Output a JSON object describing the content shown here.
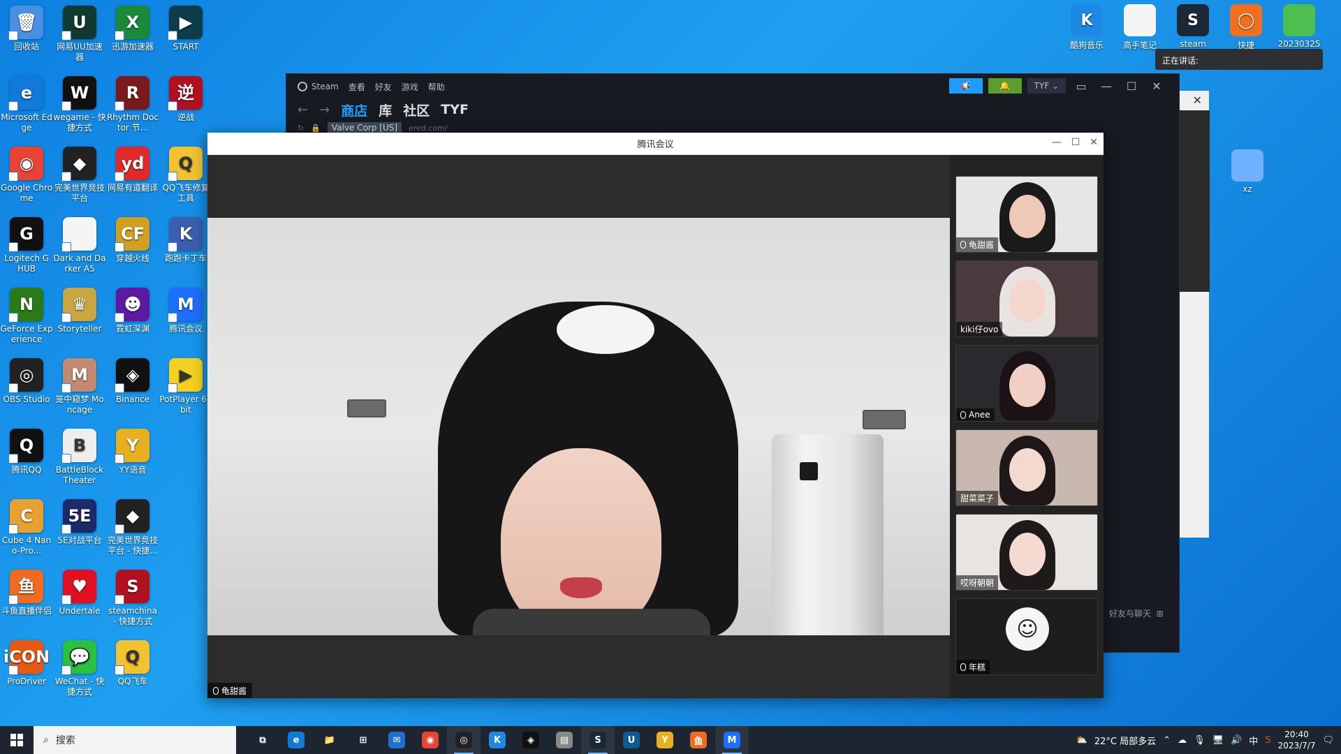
{
  "desktop": {
    "icons": [
      {
        "label": "回收站",
        "glyph": "🗑",
        "color": "#4a90e2"
      },
      {
        "label": "网易UU加速器",
        "glyph": "U",
        "color": "#0f3a2f"
      },
      {
        "label": "迅游加速器",
        "glyph": "X",
        "color": "#1a8a3a"
      },
      {
        "label": "START",
        "glyph": "▶",
        "color": "#0d3d4a"
      },
      {
        "label": "Microsoft Edge",
        "glyph": "e",
        "color": "#0f7ad8"
      },
      {
        "label": "wegame - 快捷方式",
        "glyph": "W",
        "color": "#111"
      },
      {
        "label": "Rhythm Doctor 节...",
        "glyph": "R",
        "color": "#7a1a1a"
      },
      {
        "label": "逆战",
        "glyph": "逆",
        "color": "#b01020"
      },
      {
        "label": "Google Chrome",
        "glyph": "◉",
        "color": "#e84335"
      },
      {
        "label": "完美世界竞技平台",
        "glyph": "◆",
        "color": "#222"
      },
      {
        "label": "网易有道翻译",
        "glyph": "yd",
        "color": "#e02a2a"
      },
      {
        "label": "QQ飞车修复工具",
        "glyph": "Q",
        "color": "#f2c230"
      },
      {
        "label": "Logitech G HUB",
        "glyph": "G",
        "color": "#111"
      },
      {
        "label": "Dark and Darker A5",
        "glyph": "",
        "color": "#f5f5f5"
      },
      {
        "label": "穿越火线",
        "glyph": "CF",
        "color": "#d1a020"
      },
      {
        "label": "跑跑卡丁车",
        "glyph": "K",
        "color": "#3a5fb0"
      },
      {
        "label": "GeForce Experience",
        "glyph": "N",
        "color": "#2a7a1a"
      },
      {
        "label": "Storyteller",
        "glyph": "♛",
        "color": "#caa640"
      },
      {
        "label": "霓虹深渊",
        "glyph": "☻",
        "color": "#5b1aa0"
      },
      {
        "label": "腾讯会议",
        "glyph": "M",
        "color": "#1e6fff"
      },
      {
        "label": "OBS Studio",
        "glyph": "◎",
        "color": "#222"
      },
      {
        "label": "笼中窥梦 Moncage",
        "glyph": "M",
        "color": "#c28a70"
      },
      {
        "label": "Binance",
        "glyph": "◈",
        "color": "#111"
      },
      {
        "label": "PotPlayer 64 bit",
        "glyph": "▶",
        "color": "#f5d020"
      },
      {
        "label": "腾讯QQ",
        "glyph": "Q",
        "color": "#111"
      },
      {
        "label": "BattleBlock Theater",
        "glyph": "B",
        "color": "#eee"
      },
      {
        "label": "YY语音",
        "glyph": "Y",
        "color": "#e8b020"
      },
      {
        "label": "",
        "glyph": "",
        "color": "transparent"
      },
      {
        "label": "Cube 4 Nano-Pro...",
        "glyph": "C",
        "color": "#e8a030"
      },
      {
        "label": "5E对战平台",
        "glyph": "5E",
        "color": "#1a2a6a"
      },
      {
        "label": "完美世界竞技平台 - 快捷...",
        "glyph": "◆",
        "color": "#222"
      },
      {
        "label": "",
        "glyph": "",
        "color": "transparent"
      },
      {
        "label": "斗鱼直播伴侣",
        "glyph": "鱼",
        "color": "#f06a20"
      },
      {
        "label": "Undertale",
        "glyph": "♥",
        "color": "#e01020"
      },
      {
        "label": "steamchina - 快捷方式",
        "glyph": "S",
        "color": "#b01020"
      },
      {
        "label": "",
        "glyph": "",
        "color": "transparent"
      },
      {
        "label": "ProDriver",
        "glyph": "iCON",
        "color": "#e85a10"
      },
      {
        "label": "WeChat - 快捷方式",
        "glyph": "💬",
        "color": "#2ac040"
      },
      {
        "label": "QQ飞车",
        "glyph": "Q",
        "color": "#f2c230"
      }
    ],
    "top_right_icons": [
      {
        "label": "酷狗音乐",
        "glyph": "K",
        "color": "#1e88e5"
      },
      {
        "label": "高手笔记",
        "glyph": "",
        "color": "#f5f5f5"
      },
      {
        "label": "steam",
        "glyph": "S",
        "color": "#1b2838"
      },
      {
        "label": "快捷",
        "glyph": "◯",
        "color": "#f07020"
      },
      {
        "label": "20230325真",
        "glyph": "",
        "color": "#4cbf50"
      }
    ],
    "xz_icon": {
      "label": "xz",
      "glyph": "",
      "color": "#6fb0ff"
    },
    "speaking_tooltip": "正在讲话:"
  },
  "steam": {
    "menu": [
      "Steam",
      "查看",
      "好友",
      "游戏",
      "帮助"
    ],
    "tabs": [
      "商店",
      "库",
      "社区",
      "TYF"
    ],
    "active_tab": "商店",
    "cert": "Valve Corp [US]",
    "url": "ered.com/",
    "user": "TYF",
    "friends_chat": "好友与聊天"
  },
  "meeting": {
    "title": "腾讯会议",
    "main_speaker": "龟甜酱",
    "participants": [
      {
        "name": "龟甜酱",
        "bg": "#e6e6e6",
        "hair": "#1a1a1a",
        "skin": "#efc9b8",
        "mic": true
      },
      {
        "name": "kiki仔ovo",
        "bg": "#4a3a3e",
        "hair": "#e8e2e0",
        "skin": "#f3d6cc",
        "mic": false
      },
      {
        "name": "Anee",
        "bg": "#2a2a2e",
        "hair": "#1a1214",
        "skin": "#f1cfc4",
        "mic": true
      },
      {
        "name": "甜菜菜子",
        "bg": "#c8b8b0",
        "hair": "#201818",
        "skin": "#f4d9cf",
        "mic": false
      },
      {
        "name": "哎呀朝朝",
        "bg": "#e8e4e2",
        "hair": "#1e1a1a",
        "skin": "#f4dad0",
        "mic": false
      },
      {
        "name": "年糕",
        "bg": "#1d1d1d",
        "hair": "",
        "skin": "",
        "mic": true
      }
    ]
  },
  "taskbar": {
    "search_placeholder": "搜索",
    "apps": [
      {
        "name": "task-view",
        "glyph": "⧉",
        "color": "transparent"
      },
      {
        "name": "edge",
        "glyph": "e",
        "color": "#0f7ad8"
      },
      {
        "name": "file-explorer",
        "glyph": "📁",
        "color": "transparent"
      },
      {
        "name": "ms-store",
        "glyph": "⊞",
        "color": "transparent"
      },
      {
        "name": "mail",
        "glyph": "✉",
        "color": "#1e6fd0"
      },
      {
        "name": "chrome",
        "glyph": "◉",
        "color": "#e84335"
      },
      {
        "name": "obs",
        "glyph": "◎",
        "color": "#222"
      },
      {
        "name": "kugou",
        "glyph": "K",
        "color": "#1e88e5"
      },
      {
        "name": "binance",
        "glyph": "◈",
        "color": "#111"
      },
      {
        "name": "notes",
        "glyph": "▤",
        "color": "#888"
      },
      {
        "name": "steam",
        "glyph": "S",
        "color": "#1b2838"
      },
      {
        "name": "uu",
        "glyph": "U",
        "color": "#0f5a8f"
      },
      {
        "name": "yy",
        "glyph": "Y",
        "color": "#e8b020"
      },
      {
        "name": "douyu",
        "glyph": "鱼",
        "color": "#f06a20"
      },
      {
        "name": "tencent-meeting",
        "glyph": "M",
        "color": "#1e6fff"
      }
    ],
    "weather": "22°C 局部多云",
    "ime": "中",
    "time": "20:40",
    "date": "2023/7/7"
  }
}
